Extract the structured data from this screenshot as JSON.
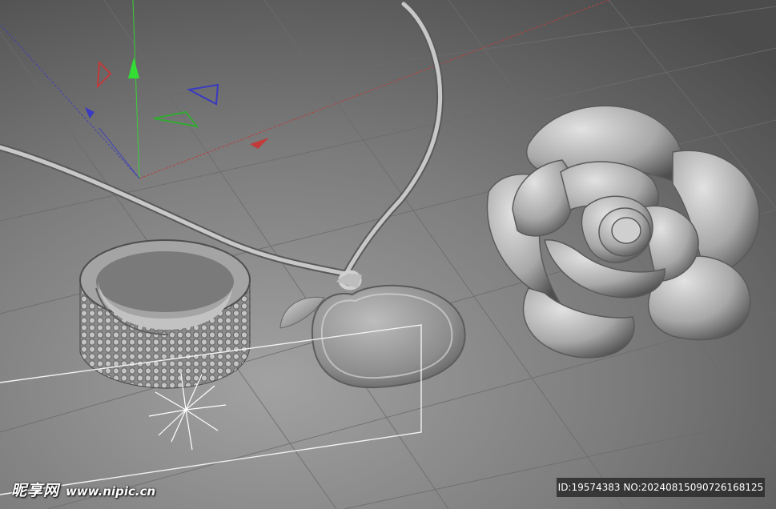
{
  "viewport": {
    "background_gradient": [
      "#9a9a9a",
      "#4a4a4a"
    ],
    "grid_color": "#6e6e6e",
    "axis_colors": {
      "x": "#c23a3a",
      "y": "#3ad23a",
      "z": "#3a3ac2"
    }
  },
  "scene": {
    "objects": [
      {
        "name": "ring",
        "icon": "ring-model"
      },
      {
        "name": "necklace-chain",
        "icon": "chain-model"
      },
      {
        "name": "apple-pendant",
        "icon": "apple-pendant-model"
      },
      {
        "name": "rose",
        "icon": "rose-model"
      },
      {
        "name": "light",
        "icon": "omni-light-icon"
      },
      {
        "name": "camera-frame",
        "icon": "camera-frame"
      }
    ]
  },
  "watermark": {
    "brand": "昵享网",
    "url": "www.nipic.cn"
  },
  "image_id": "ID:19574383 NO:20240815090726168125"
}
